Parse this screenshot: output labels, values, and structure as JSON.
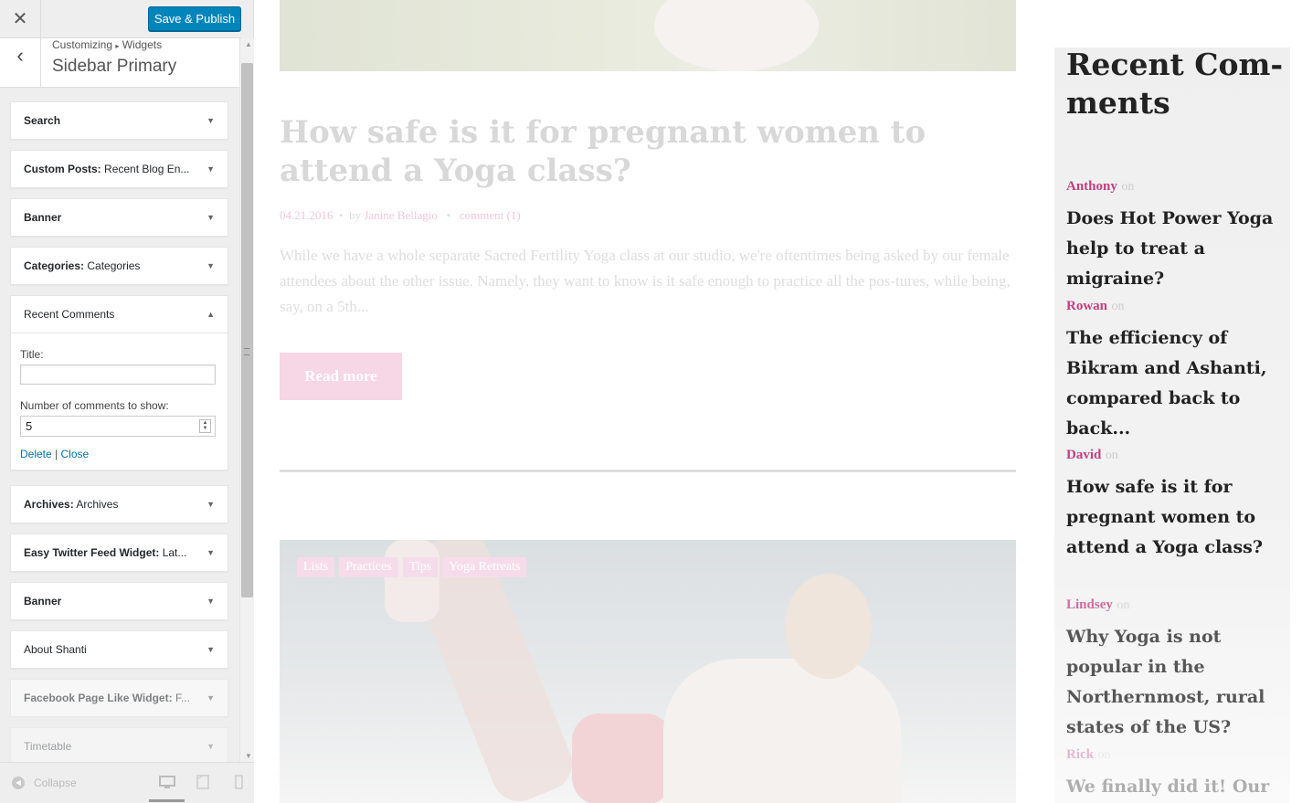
{
  "customizer": {
    "close_icon": "close-icon",
    "save_label": "Save & Publish",
    "breadcrumb_root": "Customizing",
    "breadcrumb_sep": "▸",
    "breadcrumb_current": "Widgets",
    "section_title": "Sidebar Primary",
    "widgets": [
      {
        "name": "Search",
        "title": ""
      },
      {
        "name": "Custom Posts:",
        "title": "Recent Blog En..."
      },
      {
        "name": "Banner",
        "title": ""
      },
      {
        "name": "Categories:",
        "title": "Categories"
      },
      {
        "name": "Recent Comments",
        "title": ""
      },
      {
        "name": "Archives:",
        "title": "Archives"
      },
      {
        "name": "Easy Twitter Feed Widget:",
        "title": "Lat..."
      },
      {
        "name": "Banner",
        "title": ""
      },
      {
        "name": "About Shanti",
        "title": ""
      },
      {
        "name": "Facebook Page Like Widget:",
        "title": "F..."
      },
      {
        "name": "Timetable",
        "title": ""
      }
    ],
    "recent_comments_form": {
      "title_label": "Title:",
      "title_value": "",
      "count_label": "Number of comments to show:",
      "count_value": "5",
      "delete_label": "Delete",
      "separator": "|",
      "close_label": "Close"
    },
    "footer": {
      "collapse_label": "Collapse"
    }
  },
  "preview": {
    "post": {
      "title": "How safe is it for pregnant women to attend a Yoga class?",
      "date": "04.21.2016",
      "by": "by",
      "author": "Janine Bellagio",
      "comments": "comment (1)",
      "excerpt": "While we have a whole separate Sacred Fertility Yoga class at our studio, we're oftentimes being asked by our female attendees about the other issue. Namely, they want to know is it safe enough to practice all the pos-tures, while being, say, on a 5th...",
      "read_more": "Read more"
    },
    "post2_tags": [
      "Lists",
      "Practices",
      "Tips",
      "Yoga Retreats"
    ],
    "sidebar": {
      "heading": "Recent Com-ments",
      "on_label": "on",
      "comments": [
        {
          "author": "Anthony",
          "post": "Does Hot Power Yoga help to treat a migraine?"
        },
        {
          "author": "Rowan",
          "post": "The efficiency of Bikram and Ashanti, compared back to back..."
        },
        {
          "author": "David",
          "post": "How safe is it for pregnant women to attend a Yoga class?"
        },
        {
          "author": "Lindsey",
          "post": "Why Yoga is not popular in the Northernmost, rural states of the US?"
        },
        {
          "author": "Rick",
          "post": "We finally did it! Our"
        }
      ]
    }
  },
  "colors": {
    "accent": "#0085ba",
    "link": "#0073aa",
    "pink": "#c2407f"
  }
}
